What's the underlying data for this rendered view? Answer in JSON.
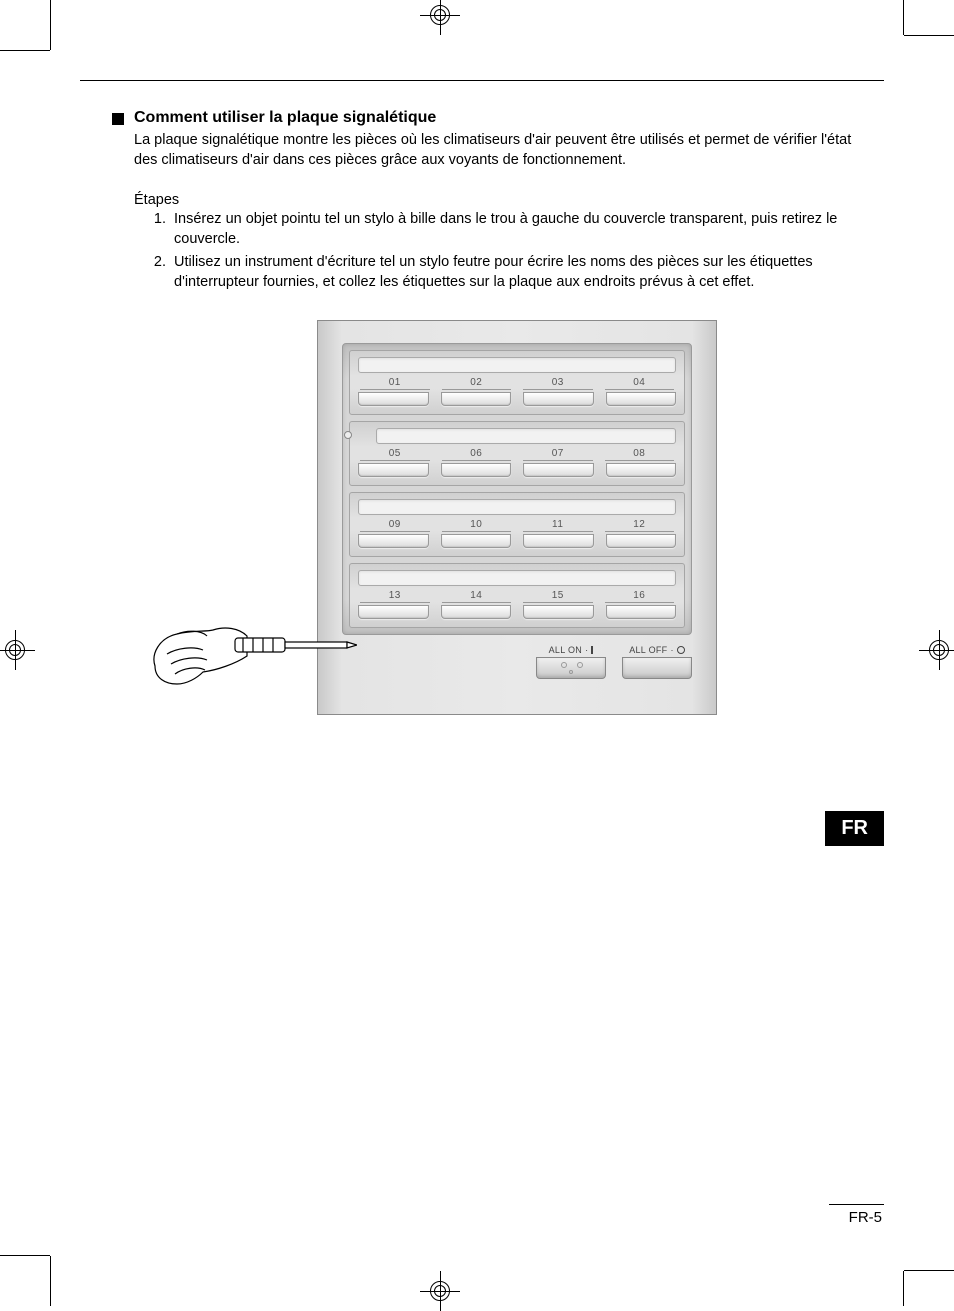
{
  "heading": "Comment utiliser la plaque signalétique",
  "intro": "La plaque signalétique montre les pièces où les climatiseurs d'air peuvent être utilisés et permet de vérifier l'état des climatiseurs d'air dans ces pièces grâce aux voyants de fonctionnement.",
  "steps_label": "Étapes",
  "steps": [
    "Insérez un objet pointu tel un stylo à bille dans le trou à gauche du couvercle transparent, puis retirez le couvercle.",
    "Utilisez un instrument d'écriture tel un stylo feutre pour écrire les noms des pièces sur les étiquettes d'interrupteur fournies, et collez les étiquettes sur la plaque aux endroits prévus à cet effet."
  ],
  "panel": {
    "groups": [
      {
        "numbers": [
          "01",
          "02",
          "03",
          "04"
        ],
        "hasDot": false
      },
      {
        "numbers": [
          "05",
          "06",
          "07",
          "08"
        ],
        "hasDot": true
      },
      {
        "numbers": [
          "09",
          "10",
          "11",
          "12"
        ],
        "hasDot": false
      },
      {
        "numbers": [
          "13",
          "14",
          "15",
          "16"
        ],
        "hasDot": false
      }
    ],
    "all_on": "ALL ON",
    "all_off": "ALL OFF"
  },
  "lang_tab": "FR",
  "page_number": "FR-5"
}
